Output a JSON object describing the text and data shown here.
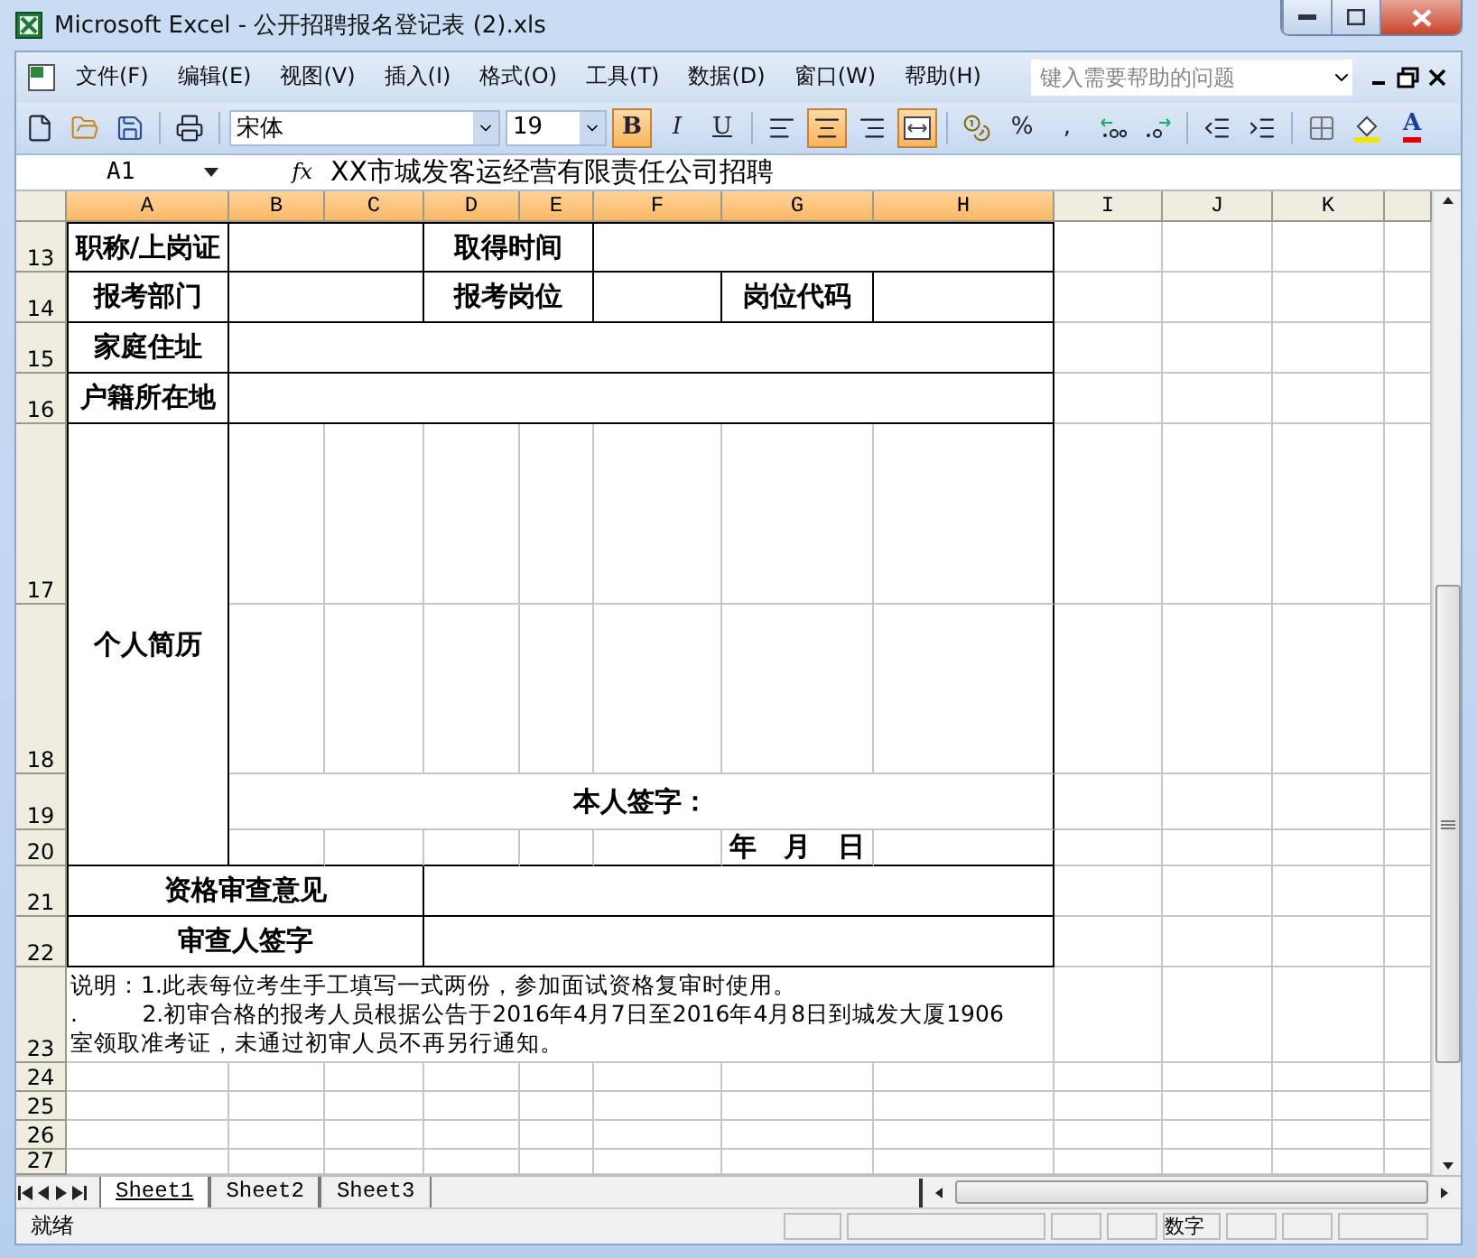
{
  "window": {
    "title": "Microsoft Excel - 公开招聘报名登记表 (2).xls"
  },
  "menu": [
    "文件(F)",
    "编辑(E)",
    "视图(V)",
    "插入(I)",
    "格式(O)",
    "工具(T)",
    "数据(D)",
    "窗口(W)",
    "帮助(H)"
  ],
  "help": {
    "placeholder": "键入需要帮助的问题"
  },
  "font": {
    "name": "宋体",
    "size": "19"
  },
  "styles": [
    {
      "label": "B",
      "selected": true
    },
    {
      "label": "I",
      "selected": false
    },
    {
      "label": "U",
      "selected": false
    }
  ],
  "align": [
    {
      "selected": false
    },
    {
      "selected": true
    },
    {
      "selected": false
    }
  ],
  "merge": {
    "selected": true
  },
  "number_format": [
    "%",
    ","
  ],
  "font_color": {
    "label": "A"
  },
  "formula_bar": {
    "cell": "A1",
    "fx": "fx",
    "value": "XX市城发客运经营有限责任公司招聘"
  },
  "columns": [
    {
      "label": "A",
      "selected": true
    },
    {
      "label": "B",
      "selected": true
    },
    {
      "label": "C",
      "selected": true
    },
    {
      "label": "D",
      "selected": true
    },
    {
      "label": "E",
      "selected": true
    },
    {
      "label": "F",
      "selected": true
    },
    {
      "label": "G",
      "selected": true
    },
    {
      "label": "H",
      "selected": true
    },
    {
      "label": "I",
      "selected": false
    },
    {
      "label": "J",
      "selected": false
    },
    {
      "label": "K",
      "selected": false
    }
  ],
  "rows": [
    "13",
    "14",
    "15",
    "16",
    "17",
    "18",
    "19",
    "20",
    "21",
    "22",
    "23",
    "24",
    "25",
    "26",
    "27"
  ],
  "form": {
    "labels": [
      "职称/上岗证",
      "取得时间",
      "报考部门",
      "报考岗位",
      "岗位代码",
      "家庭住址",
      "户籍所在地",
      "个人简历",
      "资格审查意见",
      "审查人签字"
    ],
    "signature": "本人签字：",
    "date": "年　月　日",
    "notes": [
      "说明：1.此表每位考生手工填写一式两份，参加面试资格复审时使用。",
      ".         2.初审合格的报考人员根据公告于2016年4月7日至2016年4月8日到城发大厦1906",
      "室领取准考证，未通过初审人员不再另行通知。"
    ]
  },
  "sheets": [
    {
      "label": "Sheet1",
      "selected": true
    },
    {
      "label": "Sheet2",
      "selected": false
    },
    {
      "label": "Sheet3",
      "selected": false
    }
  ],
  "status_bar": {
    "left": "就绪",
    "mode": "数字"
  }
}
